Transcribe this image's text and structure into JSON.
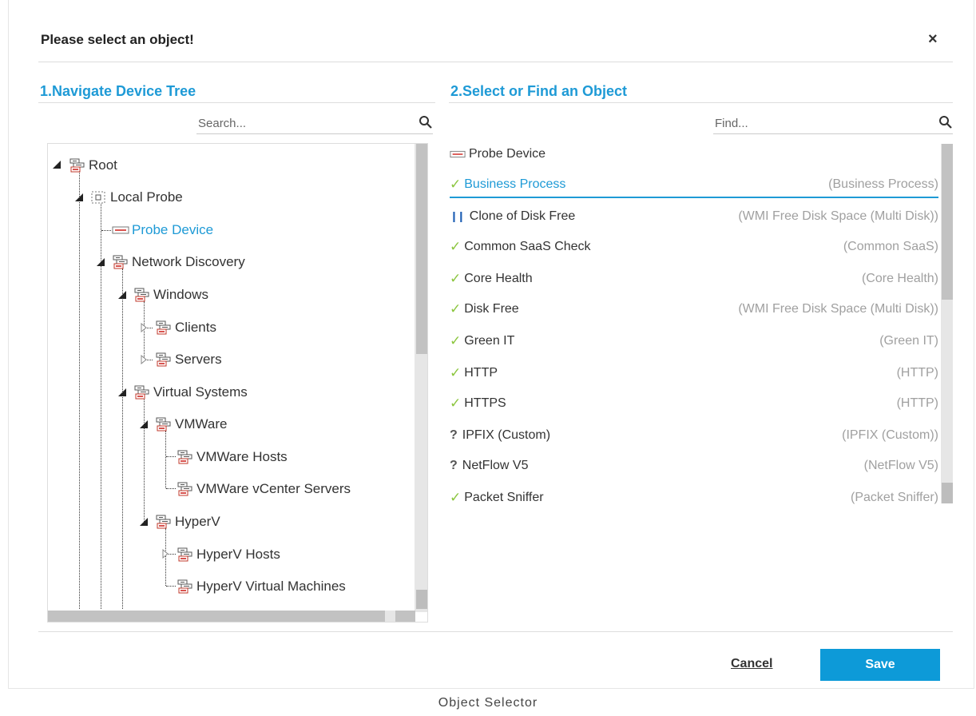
{
  "dialog": {
    "title": "Please select an object!",
    "close_label": "×"
  },
  "left": {
    "section_title": "1.Navigate Device Tree",
    "search_placeholder": "Search...",
    "tree": [
      {
        "label": "Root",
        "icon": "group-icon"
      },
      {
        "label": "Local Probe",
        "icon": "probe-icon"
      },
      {
        "label": "Probe Device",
        "icon": "probe-device-icon",
        "selected": true
      },
      {
        "label": "Network Discovery",
        "icon": "group-icon"
      },
      {
        "label": "Windows",
        "icon": "group-icon"
      },
      {
        "label": "Clients",
        "icon": "group-icon"
      },
      {
        "label": "Servers",
        "icon": "group-icon"
      },
      {
        "label": "Virtual Systems",
        "icon": "group-icon"
      },
      {
        "label": "VMWare",
        "icon": "group-icon"
      },
      {
        "label": "VMWare Hosts",
        "icon": "group-icon"
      },
      {
        "label": "VMWare vCenter Servers",
        "icon": "group-icon"
      },
      {
        "label": "HyperV",
        "icon": "group-icon"
      },
      {
        "label": "HyperV Hosts",
        "icon": "group-icon"
      },
      {
        "label": "HyperV Virtual Machines",
        "icon": "group-icon"
      }
    ]
  },
  "right": {
    "section_title": "2.Select or Find an Object",
    "find_placeholder": "Find...",
    "header_item": "Probe Device",
    "items": [
      {
        "name": "Business Process",
        "type": "(Business Process)",
        "status": "check",
        "selected": true
      },
      {
        "name": "Clone of Disk Free",
        "type": "(WMI Free Disk Space (Multi Disk))",
        "status": "paused"
      },
      {
        "name": "Common SaaS Check",
        "type": "(Common SaaS)",
        "status": "check"
      },
      {
        "name": "Core Health",
        "type": "(Core Health)",
        "status": "check"
      },
      {
        "name": "Disk Free",
        "type": "(WMI Free Disk Space (Multi Disk))",
        "status": "check"
      },
      {
        "name": "Green IT",
        "type": "(Green IT)",
        "status": "check"
      },
      {
        "name": "HTTP",
        "type": "(HTTP)",
        "status": "check"
      },
      {
        "name": "HTTPS",
        "type": "(HTTP)",
        "status": "check"
      },
      {
        "name": "IPFIX (Custom)",
        "type": "(IPFIX (Custom))",
        "status": "unknown"
      },
      {
        "name": "NetFlow V5",
        "type": "(NetFlow V5)",
        "status": "unknown"
      },
      {
        "name": "Packet Sniffer",
        "type": "(Packet Sniffer)",
        "status": "check"
      }
    ]
  },
  "footer": {
    "cancel_label": "Cancel",
    "save_label": "Save"
  },
  "caption": "Object Selector",
  "colors": {
    "accent": "#1e9ad6",
    "save": "#0d9ad8",
    "check": "#8cc63f",
    "paused": "#1e5fb4"
  }
}
